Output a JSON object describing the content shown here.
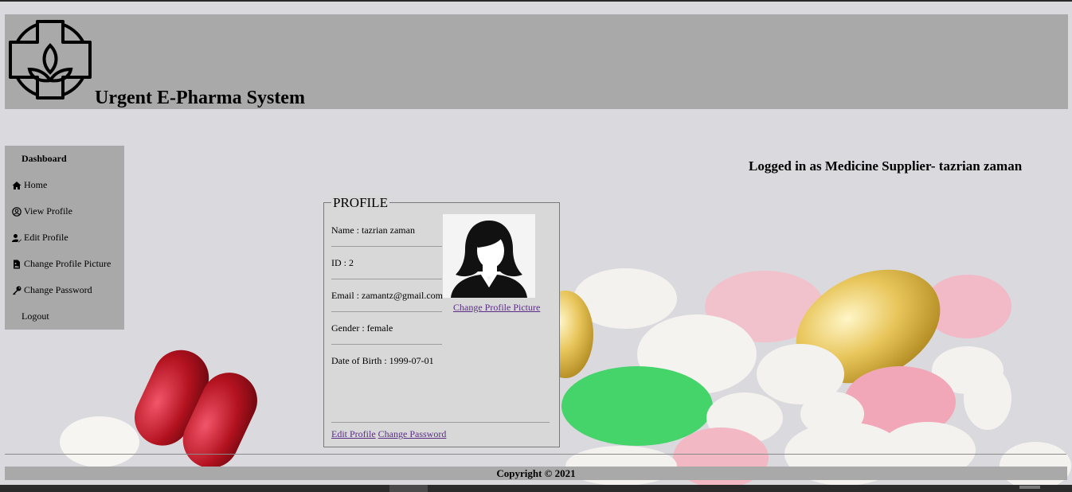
{
  "header": {
    "title": "Urgent E-Pharma System",
    "logo_icon": "pharmacy-cross-leaf-logo"
  },
  "sidebar": {
    "heading": "Dashboard",
    "items": [
      {
        "label": "Home",
        "icon": "home-icon"
      },
      {
        "label": "View Profile",
        "icon": "user-circle-icon"
      },
      {
        "label": "Edit Profile",
        "icon": "user-edit-icon"
      },
      {
        "label": "Change Profile Picture",
        "icon": "file-image-icon"
      },
      {
        "label": "Change Password",
        "icon": "key-icon"
      },
      {
        "label": "Logout",
        "icon": ""
      }
    ]
  },
  "status": {
    "logged_in_text": "Logged in as Medicine Supplier- tazrian zaman"
  },
  "profile": {
    "legend": "PROFILE",
    "name": "Name : tazrian zaman",
    "id": "ID : 2",
    "email": "Email : zamantz@gmail.com",
    "gender": "Gender : female",
    "dob": "Date of Birth : 1999-07-01",
    "change_picture_link": "Change Profile Picture",
    "edit_profile_link": "Edit Profile",
    "change_password_link": "Change Password"
  },
  "footer": {
    "copyright": "Copyright © 2021"
  },
  "colors": {
    "panel_gray": "#a9a9a9",
    "page_bg": "#dad9de",
    "link_visited": "#5a2d85"
  }
}
